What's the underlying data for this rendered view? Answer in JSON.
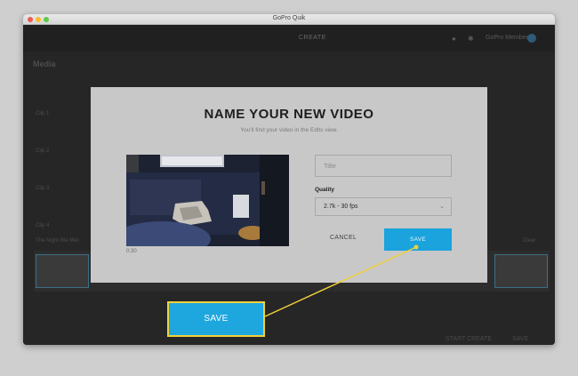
{
  "window": {
    "title": "GoPro Quik"
  },
  "nav": {
    "create": "CREATE",
    "user": "GoPro Member"
  },
  "background": {
    "media_label": "Media",
    "clip_rows": [
      "Clip 1",
      "Clip 2",
      "Clip 3",
      "Clip 4"
    ],
    "strip_left_text": "The Night We Met",
    "strip_right_text": "Clear",
    "bottom_buttons": [
      "START CREATE",
      "SAVE"
    ]
  },
  "modal": {
    "title": "NAME YOUR NEW VIDEO",
    "subtitle": "You'll find your video in the Edits view.",
    "duration": "0:30",
    "title_placeholder": "Title",
    "quality_label": "Quality",
    "quality_value": "2.7k - 30 fps",
    "cancel_label": "CANCEL",
    "save_label": "SAVE"
  },
  "callout": {
    "save_label": "SAVE"
  },
  "colors": {
    "accent": "#1aa3dd",
    "highlight": "#f0d03a",
    "modal_bg": "#c8c8c8",
    "app_bg": "#262626"
  },
  "icons": [
    "chevron-down-icon",
    "settings-icon",
    "notification-icon"
  ]
}
